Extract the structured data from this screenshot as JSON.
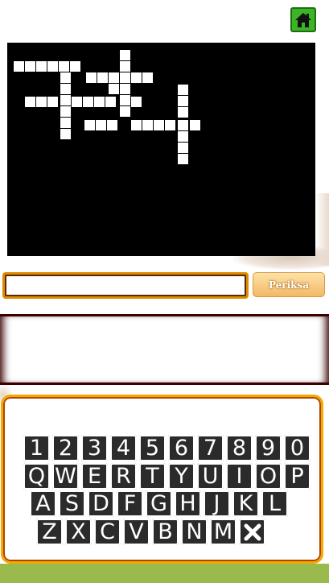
{
  "header": {
    "home_icon": "home-icon"
  },
  "answer": {
    "value": "",
    "placeholder": ""
  },
  "check_button": {
    "label": "Periksa"
  },
  "clue": {
    "text": ""
  },
  "keyboard": {
    "rows": [
      [
        "1",
        "2",
        "3",
        "4",
        "5",
        "6",
        "7",
        "8",
        "9",
        "0"
      ],
      [
        "Q",
        "W",
        "E",
        "R",
        "T",
        "Y",
        "U",
        "I",
        "O",
        "P"
      ],
      [
        "A",
        "S",
        "D",
        "F",
        "G",
        "H",
        "J",
        "K",
        "L"
      ],
      [
        "Z",
        "X",
        "C",
        "V",
        "B",
        "N",
        "M"
      ]
    ],
    "backspace_icon": "close-x-icon"
  },
  "colors": {
    "board": "#000000",
    "cell": "#ffffff",
    "accent_orange": "#f2a900",
    "home_green": "#3bb526",
    "bottom_band": "#9aba4e"
  }
}
